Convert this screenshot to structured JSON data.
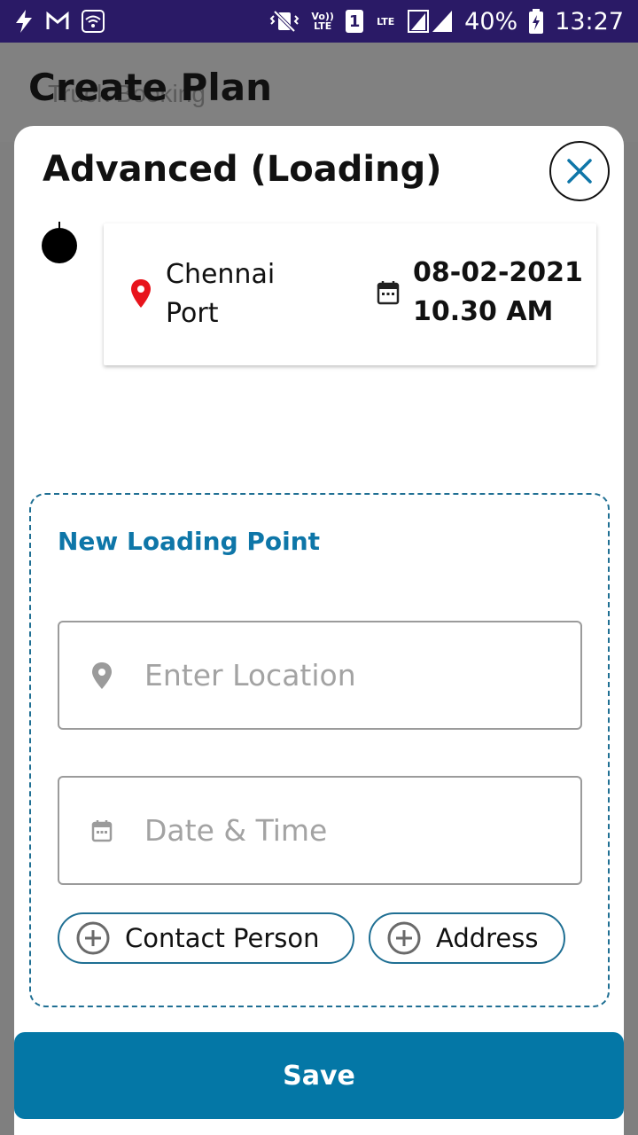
{
  "status_bar": {
    "battery_percent": "40%",
    "time": "13:27",
    "volte_label": "Vo)) LTE",
    "sim_label": "1",
    "lte_label": "LTE",
    "icons": [
      "flash-icon",
      "gmail-icon",
      "wifi-icon",
      "vibrate-icon",
      "signal-icon",
      "battery-charging-icon"
    ]
  },
  "background_screen": {
    "title": "Create Plan",
    "subtitle": "Truck Booking"
  },
  "sheet": {
    "title": "Advanced (Loading)",
    "close_icon": "close-icon"
  },
  "existing_point": {
    "location": "Chennai Port",
    "date": "08-02-2021",
    "time": "10.30 AM",
    "pin_color": "#e8141c"
  },
  "new_point": {
    "title": "New Loading Point",
    "location_placeholder": "Enter Location",
    "datetime_placeholder": "Date & Time",
    "contact_label": "Contact Person",
    "address_label": "Address"
  },
  "save_label": "Save",
  "colors": {
    "accent": "#0477a6",
    "status_bar": "#2a1a66"
  }
}
